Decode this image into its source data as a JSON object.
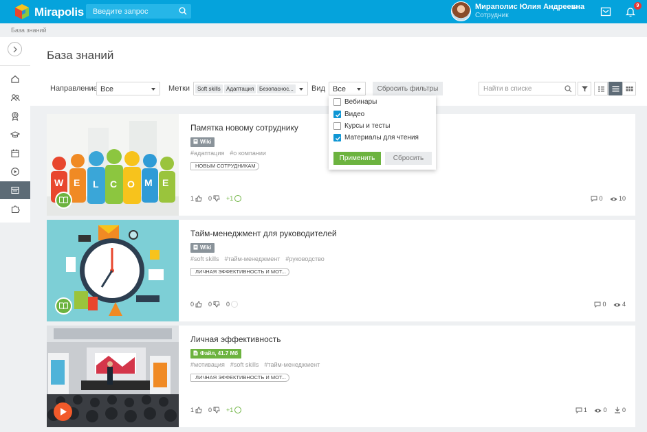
{
  "app": {
    "name": "Mirapolis"
  },
  "search": {
    "placeholder": "Введите запрос"
  },
  "user": {
    "name": "Мираполис Юлия Андреевна",
    "role": "Сотрудник"
  },
  "notifications": {
    "count": "9"
  },
  "breadcrumb": "База знаний",
  "page": {
    "title": "База знаний"
  },
  "filters": {
    "direction": {
      "label": "Направление",
      "value": "Все"
    },
    "tags": {
      "label": "Метки",
      "chips": [
        "Soft skills",
        "Адаптация",
        "Безопаснос..."
      ]
    },
    "view": {
      "label": "Вид",
      "value": "Все"
    },
    "reset_label": "Сбросить фильтры",
    "list_search_placeholder": "Найти в списке"
  },
  "view_dropdown": {
    "options": [
      {
        "label": "Вебинары",
        "checked": false
      },
      {
        "label": "Видео",
        "checked": true
      },
      {
        "label": "Курсы и тесты",
        "checked": false
      },
      {
        "label": "Материалы для чтения",
        "checked": true
      }
    ],
    "apply_label": "Применить",
    "clear_label": "Сбросить"
  },
  "cards": [
    {
      "title": "Памятка новому сотруднику",
      "type": "Wiki",
      "tags": [
        "#адаптация",
        "#о компании"
      ],
      "label": "НОВЫМ СОТРУДНИКАМ",
      "likes": "1",
      "dislikes": "0",
      "rating": "+1",
      "comments": "0",
      "views": "10"
    },
    {
      "title": "Тайм-менеджмент для руководителей",
      "type": "Wiki",
      "tags": [
        "#soft skills",
        "#тайм-менеджмент",
        "#руководство"
      ],
      "label": "ЛИЧНАЯ ЭФФЕКТИВНОСТЬ И МОТ...",
      "likes": "0",
      "dislikes": "0",
      "rating": "0",
      "comments": "0",
      "views": "4"
    },
    {
      "title": "Личная эффективность",
      "type": "Файл, 41.7 Мб",
      "tags": [
        "#мотивация",
        "#soft skills",
        "#тайм-менеджмент"
      ],
      "label": "ЛИЧНАЯ ЭФФЕКТИВНОСТЬ И МОТ...",
      "likes": "1",
      "dislikes": "0",
      "rating": "+1",
      "comments": "1",
      "views": "0",
      "downloads": "0"
    }
  ],
  "thumb_letters": [
    "W",
    "E",
    "L",
    "C",
    "O",
    "M",
    "E"
  ],
  "colors": {
    "topbar": "#05a3dc",
    "accent_green": "#6cb33f",
    "checkbox_blue": "#0f96d4",
    "rail_active": "#5d6b76"
  }
}
